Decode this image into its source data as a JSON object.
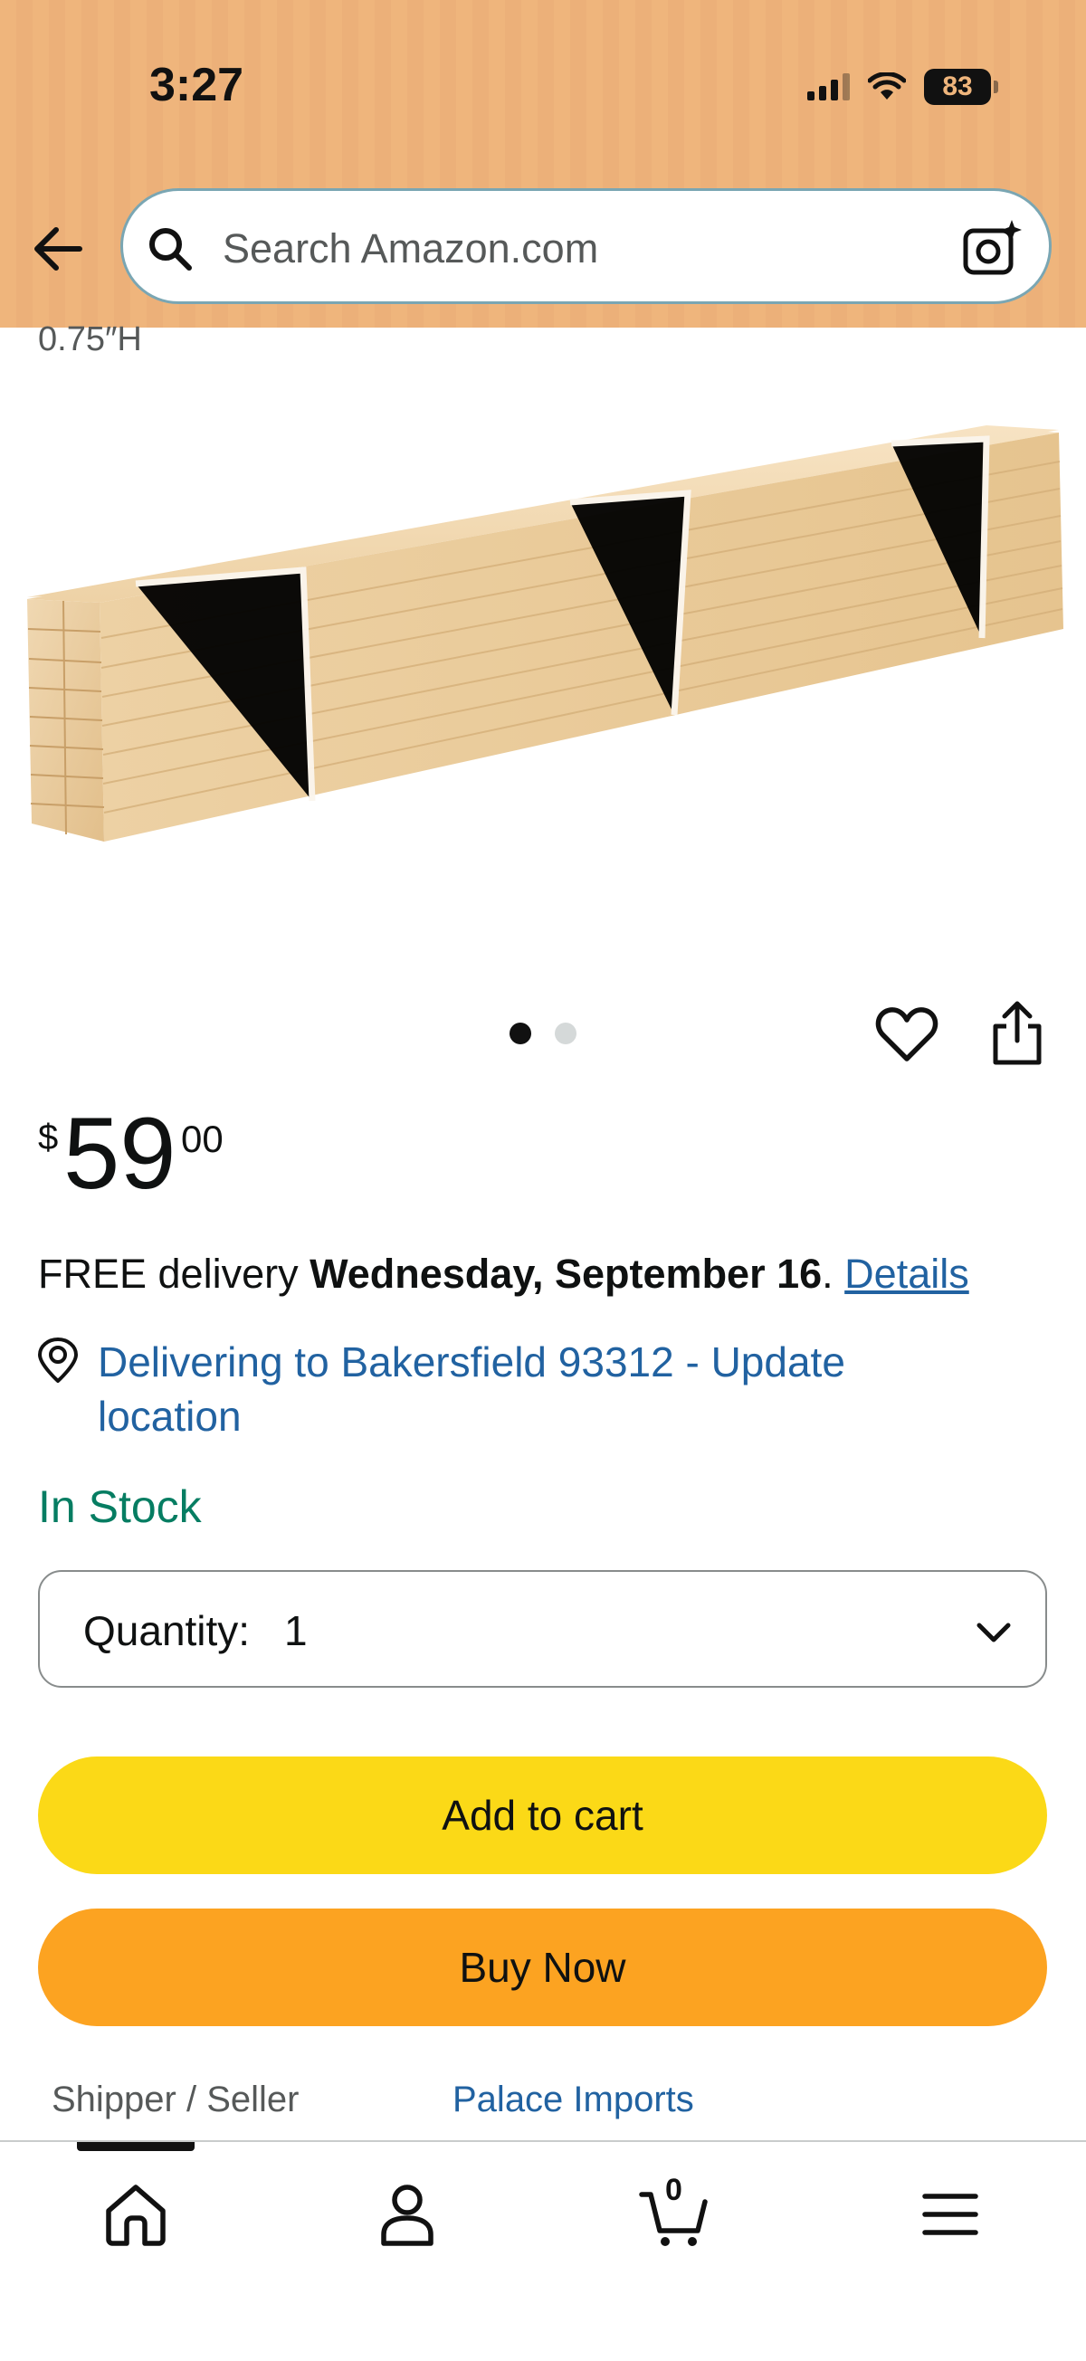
{
  "status_bar": {
    "time": "3:27",
    "battery": "83"
  },
  "search": {
    "placeholder": "Search Amazon.com"
  },
  "product": {
    "spec_fragment": "0.75″H"
  },
  "carousel": {
    "total_images": 2,
    "active_index": 0
  },
  "price": {
    "symbol": "$",
    "whole": "59",
    "fraction": "00"
  },
  "delivery": {
    "prefix": "FREE delivery ",
    "date": "Wednesday, September 16",
    "separator": ". ",
    "details_link": "Details"
  },
  "location": {
    "text": "Delivering to Bakersfield 93312 - Update location"
  },
  "stock": {
    "status": "In Stock"
  },
  "quantity": {
    "label": "Quantity:",
    "value": "1"
  },
  "buttons": {
    "add_to_cart": "Add to cart",
    "buy_now": "Buy Now"
  },
  "seller": {
    "label": "Shipper / Seller",
    "value": "Palace Imports"
  },
  "bottom_nav": {
    "cart_count": "0",
    "items": [
      "home-icon",
      "account-icon",
      "cart-icon",
      "menu-icon"
    ]
  },
  "colors": {
    "header_bg": "#efb57c",
    "link": "#2162a1",
    "in_stock": "#067d62",
    "add_to_cart": "#fbd917",
    "buy_now": "#fca321"
  }
}
